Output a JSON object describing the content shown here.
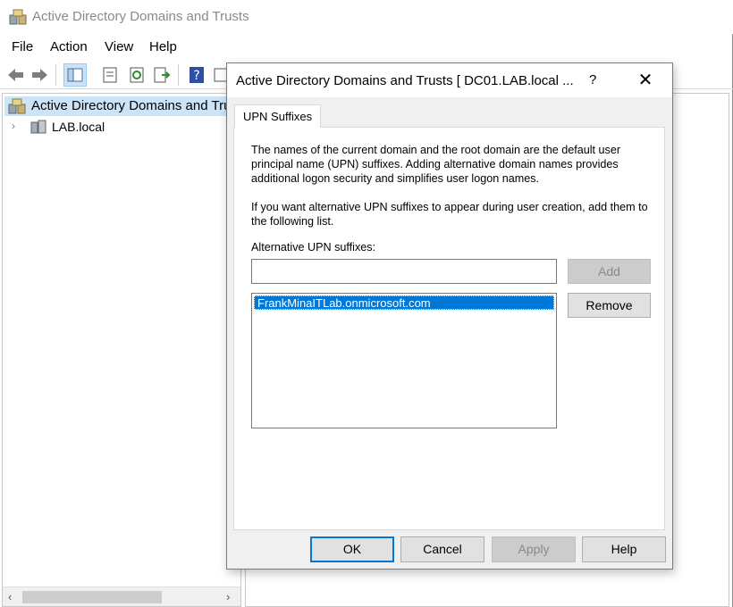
{
  "app": {
    "title": "Active Directory Domains and Trusts"
  },
  "menu": {
    "file": "File",
    "action": "Action",
    "view": "View",
    "help": "Help"
  },
  "toolbar": {
    "icons": [
      "back-arrow-icon",
      "forward-arrow-icon",
      "show-hide-tree-icon",
      "properties-icon",
      "refresh-icon",
      "export-list-icon",
      "help-icon",
      "show-action-pane-icon"
    ]
  },
  "tree": {
    "root_label": "Active Directory Domains and Trusts",
    "child_label": "LAB.local"
  },
  "dialog": {
    "title": "Active Directory Domains and Trusts [ DC01.LAB.local ...",
    "help_glyph": "?",
    "close_glyph": "✕",
    "tab_label": "UPN Suffixes",
    "para1": "The names of the current domain and the root domain are the default user principal name (UPN) suffixes. Adding alternative domain names provides additional logon security and simplifies user logon names.",
    "para2": "If you want alternative UPN suffixes to appear during user creation, add them to the following list.",
    "alt_label": "Alternative UPN suffixes:",
    "input_value": "",
    "suffixes": [
      "FrankMinaITLab.onmicrosoft.com"
    ],
    "add_label": "Add",
    "remove_label": "Remove",
    "ok_label": "OK",
    "cancel_label": "Cancel",
    "apply_label": "Apply",
    "help_label": "Help"
  },
  "colors": {
    "selection": "#0078d7",
    "tree_selection": "#cce4f7",
    "dialog_bg": "#f0f0f0"
  }
}
